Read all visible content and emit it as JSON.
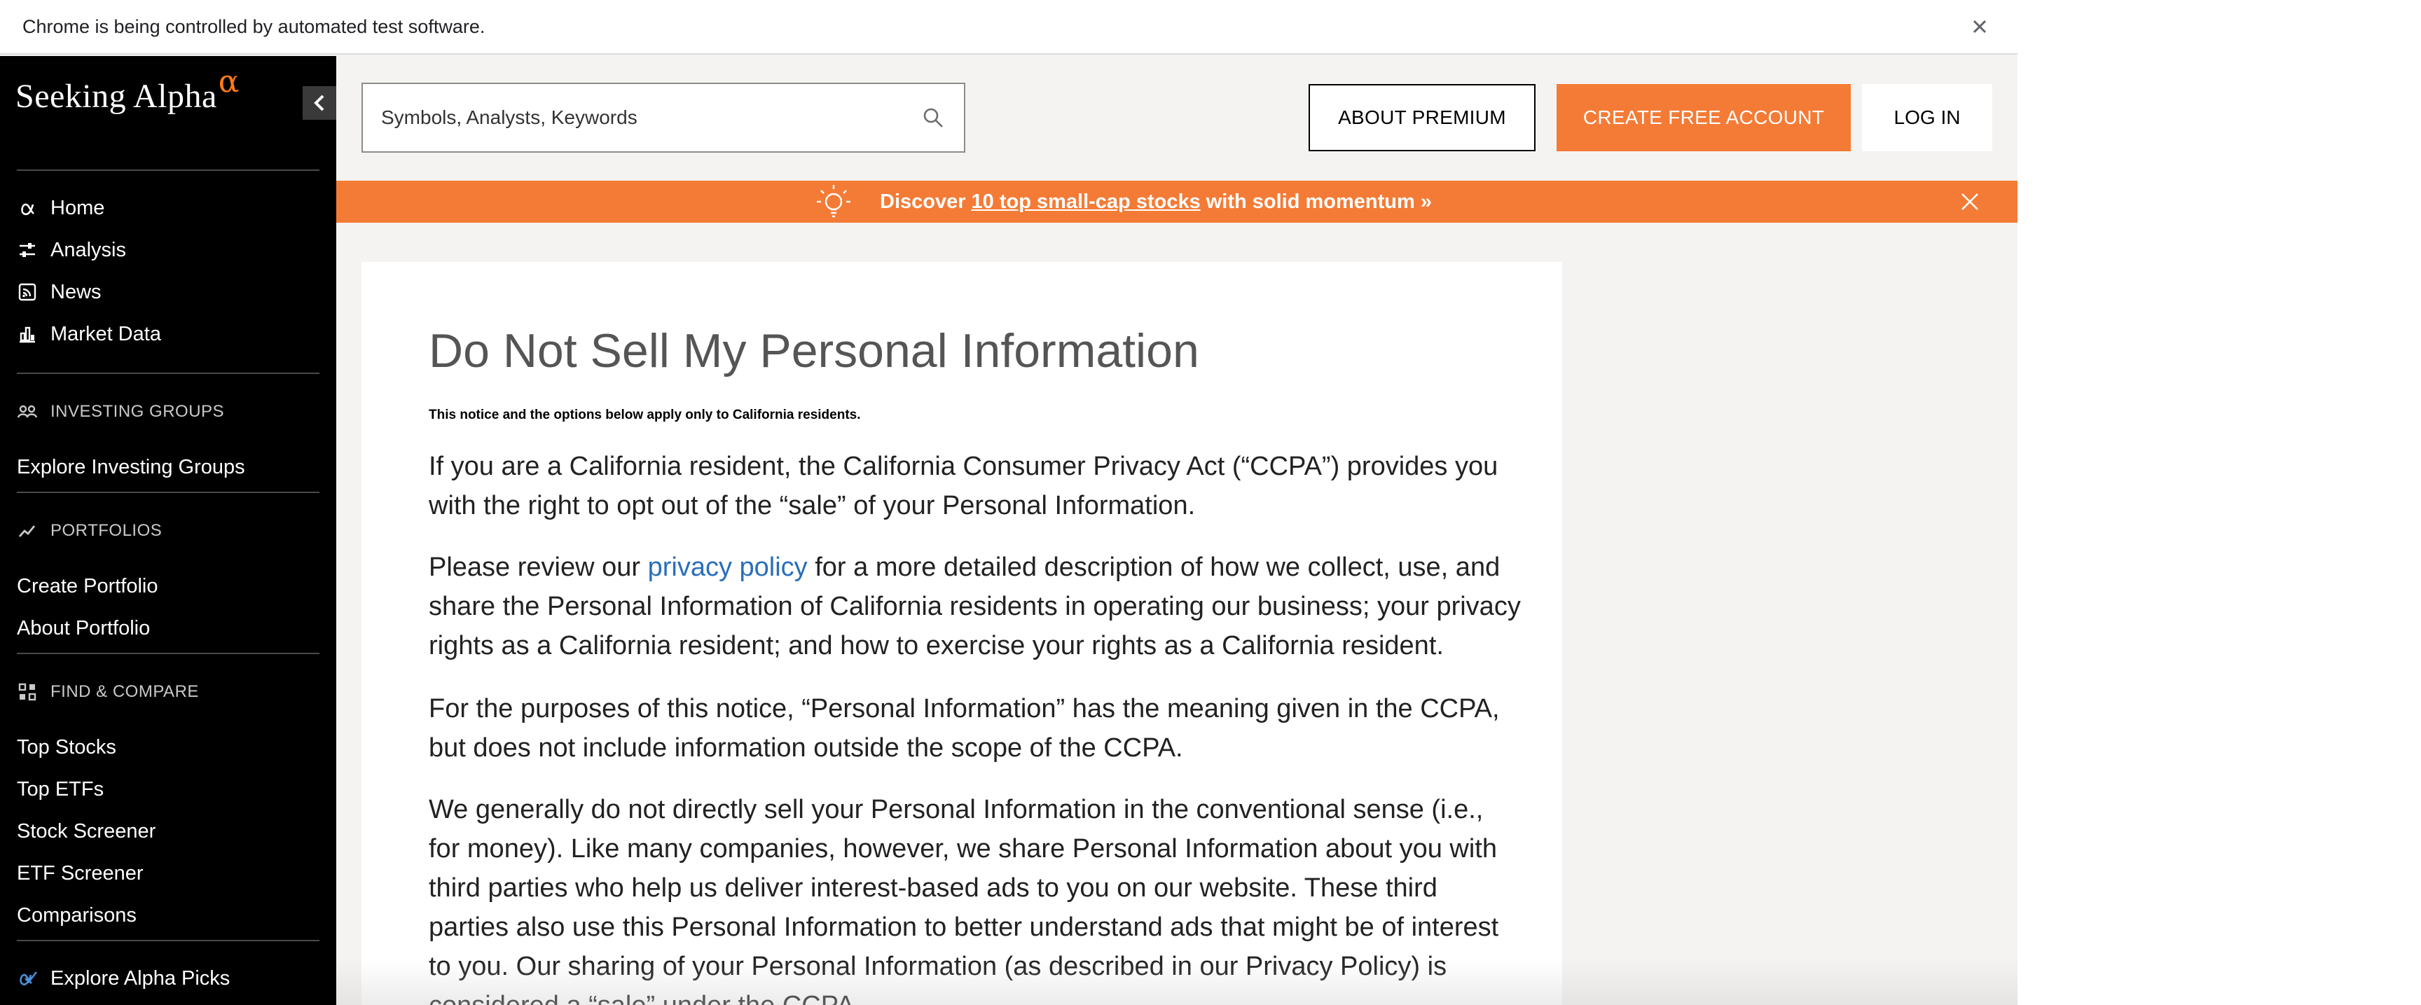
{
  "infobar": {
    "message": "Chrome is being controlled by automated test software."
  },
  "sidebar": {
    "logo_text": "Seeking Alpha",
    "logo_mark": "α",
    "main_nav": [
      {
        "label": "Home",
        "icon": "alpha-icon"
      },
      {
        "label": "Analysis",
        "icon": "sliders-icon"
      },
      {
        "label": "News",
        "icon": "rss-icon"
      },
      {
        "label": "Market Data",
        "icon": "bar-chart-icon"
      }
    ],
    "investing_groups": {
      "heading": "INVESTING GROUPS",
      "links": [
        "Explore Investing Groups"
      ]
    },
    "portfolios": {
      "heading": "PORTFOLIOS",
      "links": [
        "Create Portfolio",
        "About Portfolio"
      ]
    },
    "find_compare": {
      "heading": "FIND & COMPARE",
      "links": [
        "Top Stocks",
        "Top ETFs",
        "Stock Screener",
        "ETF Screener",
        "Comparisons"
      ]
    },
    "alpha_picks": "Explore Alpha Picks"
  },
  "header": {
    "search_placeholder": "Symbols, Analysts, Keywords",
    "about_premium": "ABOUT PREMIUM",
    "create_account": "CREATE FREE ACCOUNT",
    "log_in": "LOG IN"
  },
  "promo": {
    "prefix": "Discover",
    "link": "10 top small-cap stocks",
    "suffix": "with solid momentum »"
  },
  "article": {
    "title": "Do Not Sell My Personal Information",
    "notice": "This notice and the options below apply only to California residents.",
    "p1": "If you are a California resident, the California Consumer Privacy Act (“CCPA”) provides you with the right to opt out of the “sale” of your Personal Information.",
    "p2_before": "Please review our ",
    "p2_link": "privacy policy",
    "p2_after": " for a more detailed description of how we collect, use, and share the Personal Information of California residents in operating our business; your privacy rights as a California resident; and how to exercise your rights as a California resident.",
    "p3": "For the purposes of this notice, “Personal Information” has the meaning given in the CCPA, but does not include information outside the scope of the CCPA.",
    "p4": "We generally do not directly sell your Personal Information in the conventional sense (i.e., for money). Like many companies, however, we share Personal Information about you with third parties who help us deliver interest-based ads to you on our website. These third parties also use this Personal Information to better understand ads that might be of interest to you. Our sharing of your Personal Information (as described in our Privacy Policy) is considered a “sale” under the CCPA."
  },
  "colors": {
    "brand_orange": "#f47b36",
    "sidebar_bg": "#000000",
    "link_blue": "#2a6ebb",
    "page_bg": "#f5f3f1"
  }
}
